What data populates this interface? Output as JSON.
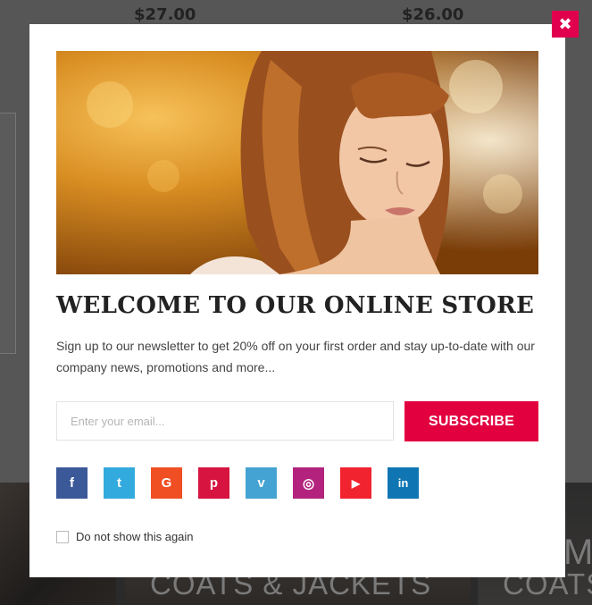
{
  "background": {
    "prices": [
      "$27.00",
      "$26.00"
    ],
    "tiles": [
      "COATS & JACKETS",
      "COATS"
    ],
    "tile_big_text": "M"
  },
  "modal": {
    "close_icon": "✖",
    "title": "WELCOME TO OUR ONLINE STORE",
    "description": "Sign up to our newsletter to get 20% off on your first order and stay up-to-date with our company news, promotions and more...",
    "email_placeholder": "Enter your email...",
    "subscribe_label": "SUBSCRIBE",
    "do_not_show_label": "Do not show this again",
    "socials": [
      {
        "name": "facebook-icon",
        "glyph": "f",
        "color": "#3b5998"
      },
      {
        "name": "twitter-icon",
        "glyph": "t",
        "color": "#33aadd"
      },
      {
        "name": "google-icon",
        "glyph": "G",
        "color": "#f04e23"
      },
      {
        "name": "pinterest-icon",
        "glyph": "p",
        "color": "#d7143f"
      },
      {
        "name": "vimeo-icon",
        "glyph": "v",
        "color": "#44a3d2"
      },
      {
        "name": "instagram-icon",
        "glyph": "◎",
        "color": "#b3237e"
      },
      {
        "name": "youtube-icon",
        "glyph": "▶",
        "color": "#f0232f"
      },
      {
        "name": "linkedin-icon",
        "glyph": "in",
        "color": "#0f76b3"
      }
    ],
    "colors": {
      "accent": "#e2003f",
      "close": "#e0004d"
    }
  }
}
